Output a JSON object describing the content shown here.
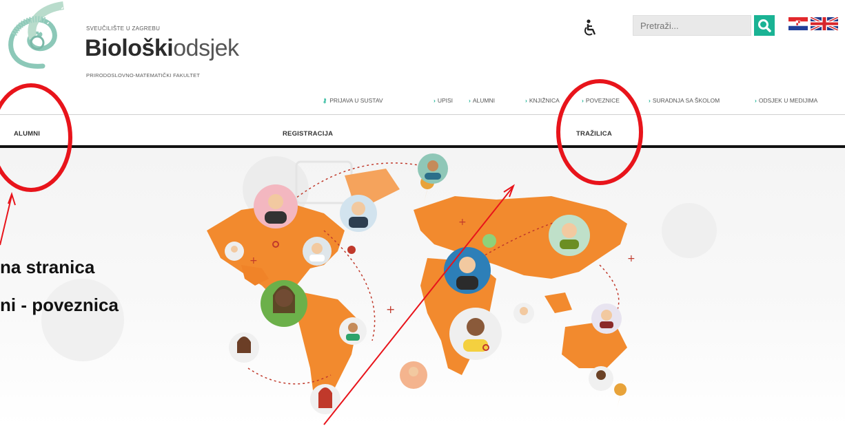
{
  "header": {
    "brand_small": "SVEUČILIŠTE U ZAGREBU",
    "brand_big_bold": "Biološki",
    "brand_big_light": "odsjek",
    "brand_sub": "PRIRODOSLOVNO-MATEMATIČKI FAKULTET",
    "search_placeholder": "Pretraži...",
    "accent_color": "#1ab394"
  },
  "topnav": {
    "items": [
      {
        "label": "PRIJAVA U SUSTAV",
        "icon": "key-icon"
      },
      {
        "label": "UPISI",
        "icon": "chevron-right-icon"
      },
      {
        "label": "ALUMNI",
        "icon": "chevron-right-icon"
      },
      {
        "label": "KNJIŽNICA",
        "icon": "chevron-right-icon"
      },
      {
        "label": "POVEZNICE",
        "icon": "chevron-right-icon"
      },
      {
        "label": "SURADNJA SA ŠKOLOM",
        "icon": "chevron-right-icon"
      },
      {
        "label": "ODSJEK U MEDIJIMA",
        "icon": "chevron-right-icon"
      }
    ]
  },
  "tabs": [
    {
      "label": "ALUMNI"
    },
    {
      "label": "REGISTRACIJA"
    },
    {
      "label": "TRAŽILICA"
    }
  ],
  "annotation": {
    "line1": "na stranica",
    "line2": "ni - poveznica",
    "highlight_color": "#e8141b"
  }
}
